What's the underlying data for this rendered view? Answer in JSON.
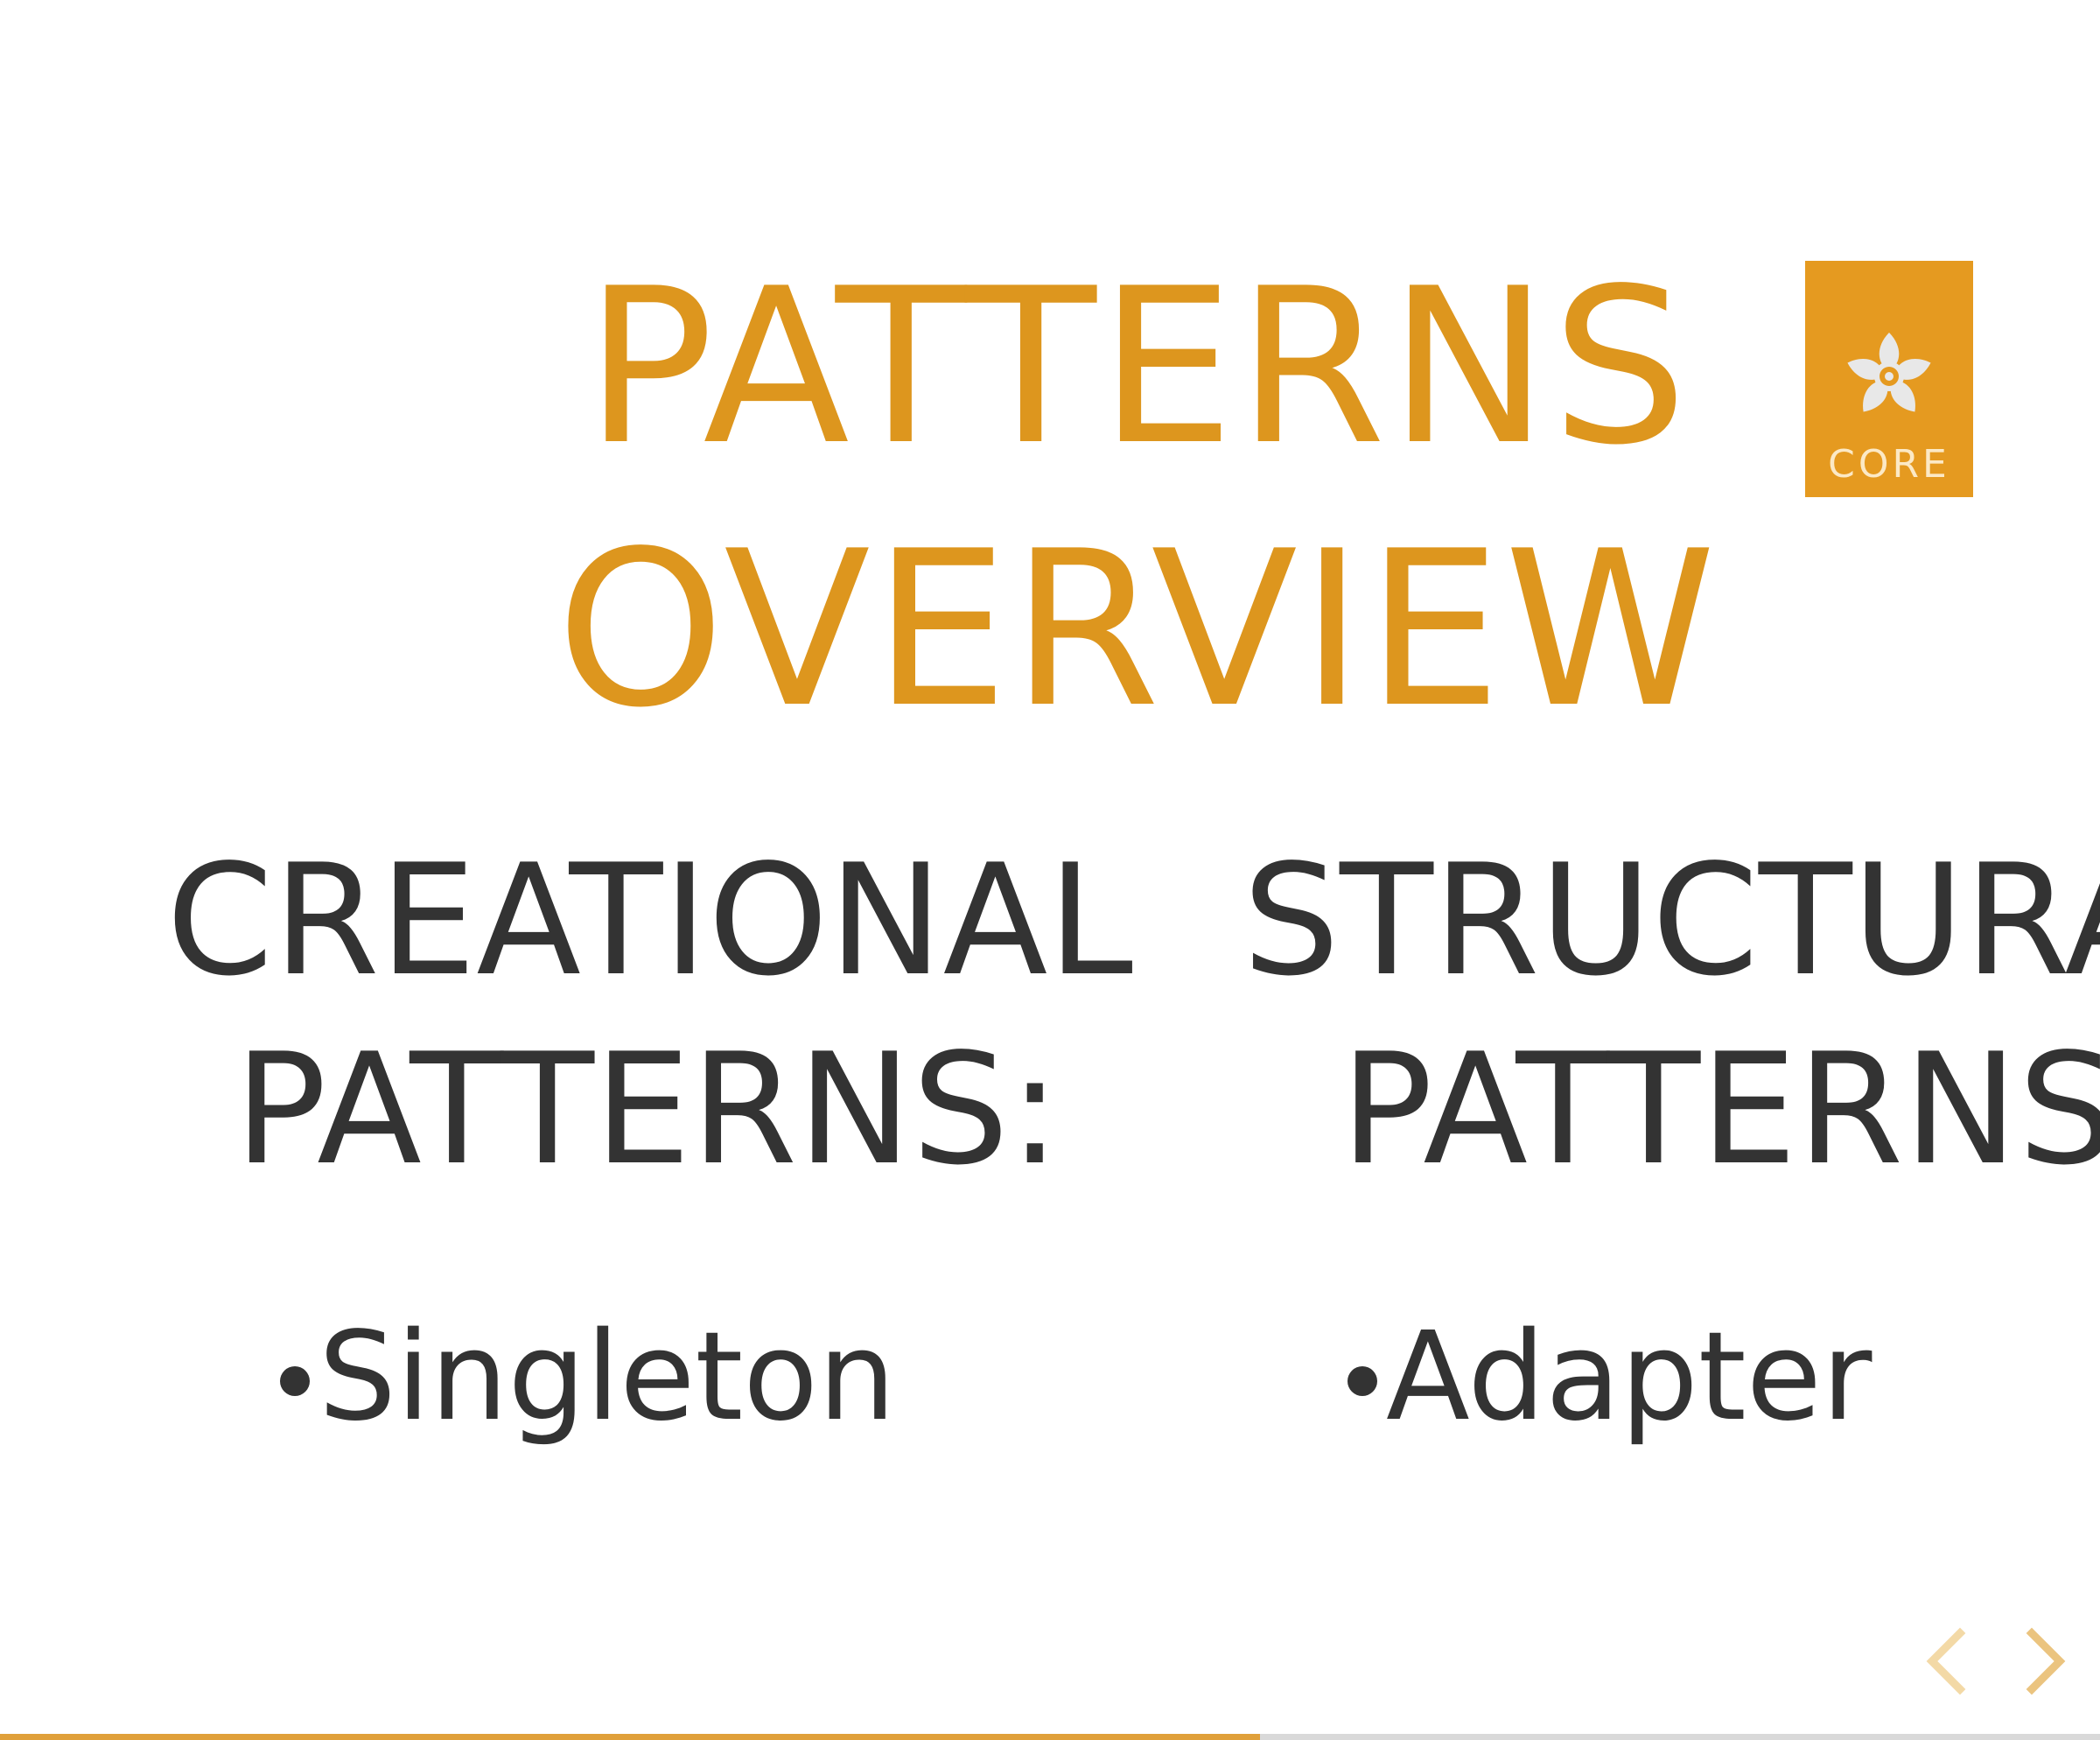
{
  "slide": {
    "title_line1": "PATTERNS",
    "title_line2": "OVERVIEW",
    "badge_label": "CORE",
    "badge_icon": "flower-icon",
    "accent_color": "#dd961e"
  },
  "columns": [
    {
      "heading_line1": "CREATIONAL",
      "heading_line2": "PATTERNS:",
      "items": [
        "Singleton"
      ]
    },
    {
      "heading_line1": "STRUCTURAL",
      "heading_line2": "PATTERNS:",
      "items": [
        "Adapter"
      ]
    }
  ],
  "navigation": {
    "prev_icon": "chevron-left-icon",
    "next_icon": "chevron-right-icon",
    "progress_fraction": 0.6
  }
}
